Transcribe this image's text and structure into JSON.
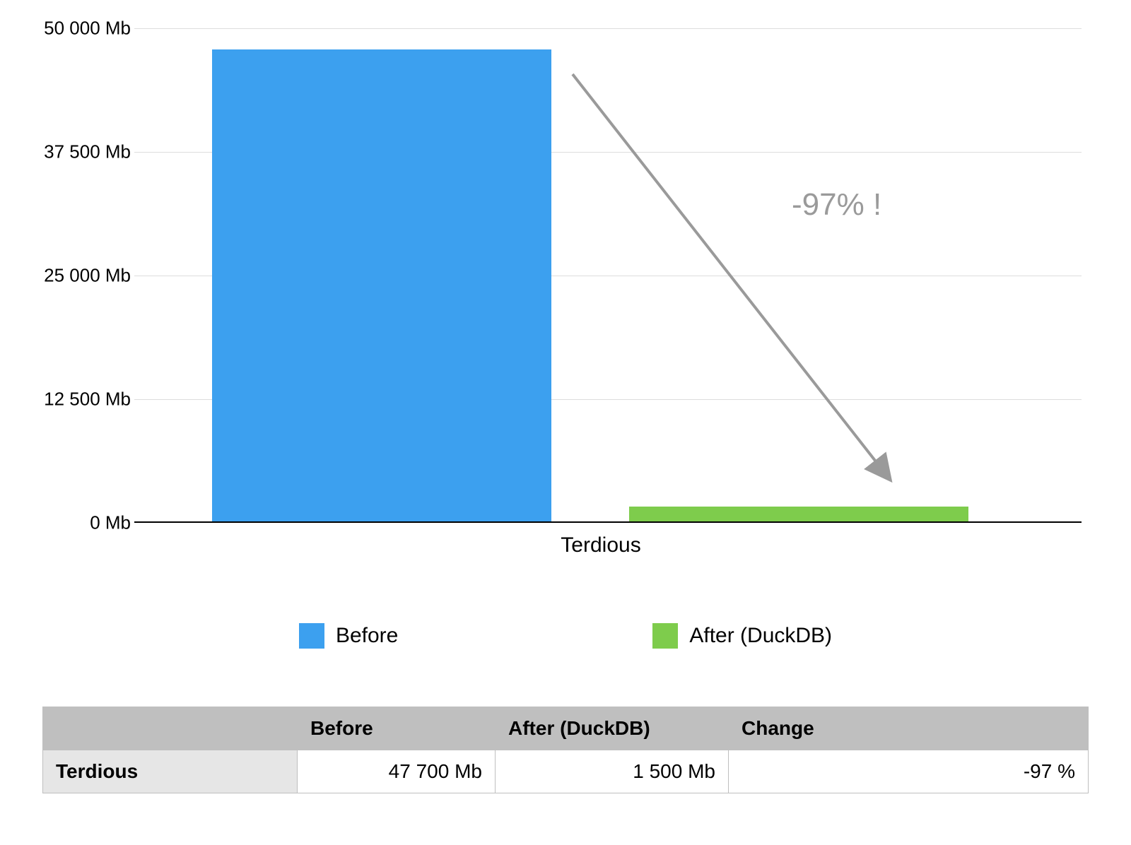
{
  "chart_data": {
    "type": "bar",
    "categories": [
      "Terdious"
    ],
    "series": [
      {
        "name": "Before",
        "values": [
          47700
        ],
        "color": "#3ca0ef"
      },
      {
        "name": "After (DuckDB)",
        "values": [
          1500
        ],
        "color": "#7ecc4c"
      }
    ],
    "y_ticks": [
      0,
      12500,
      25000,
      37500,
      50000
    ],
    "y_tick_labels": [
      "0 Mb",
      "12 500 Mb",
      "25 000 Mb",
      "37 500 Mb",
      "50 000 Mb"
    ],
    "ymax": 50000,
    "unit": "Mb",
    "annotation": "-97% !",
    "xlabel": "",
    "ylabel": "",
    "title": ""
  },
  "legend": {
    "before": "Before",
    "after": "After (DuckDB)"
  },
  "xcat": {
    "label": "Terdious"
  },
  "annotation_text": "-97% !",
  "table": {
    "headers": {
      "blank": "",
      "before": "Before",
      "after": "After (DuckDB)",
      "change": "Change"
    },
    "row": {
      "label": "Terdious",
      "before": "47 700 Mb",
      "after": "1 500 Mb",
      "change": "-97 %"
    }
  },
  "yticks": {
    "t0": "0 Mb",
    "t1": "12 500 Mb",
    "t2": "25 000 Mb",
    "t3": "37 500 Mb",
    "t4": "50 000 Mb"
  }
}
